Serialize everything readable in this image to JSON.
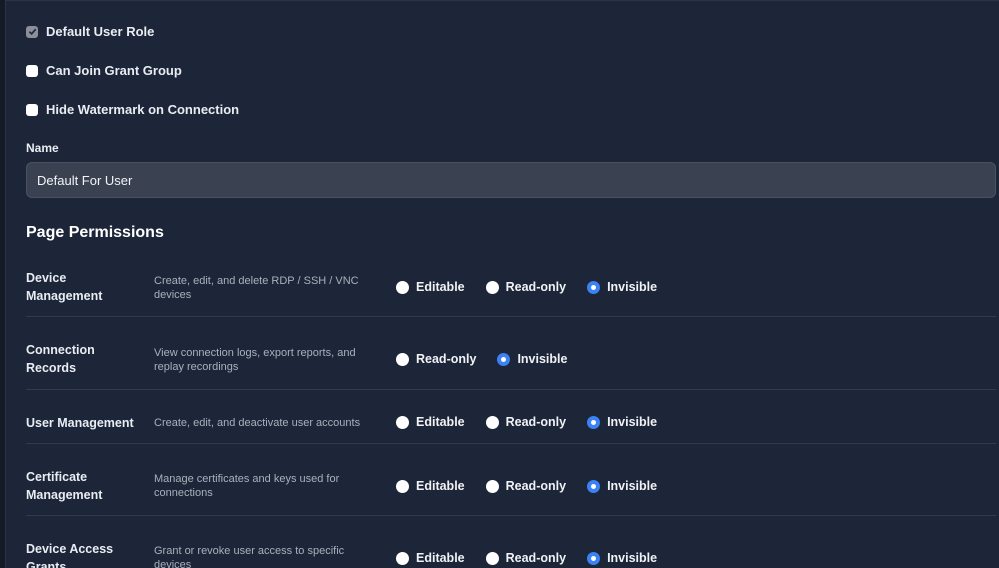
{
  "checkboxes": [
    {
      "label": "Default User Role",
      "checked": true
    },
    {
      "label": "Can Join Grant Group",
      "checked": false
    },
    {
      "label": "Hide Watermark on Connection",
      "checked": false
    }
  ],
  "name_field": {
    "label": "Name",
    "value": "Default For User"
  },
  "permissions": {
    "title": "Page Permissions",
    "rows": [
      {
        "name": "Device Management",
        "description": "Create, edit, and delete RDP / SSH / VNC devices",
        "options": [
          "Editable",
          "Read-only",
          "Invisible"
        ],
        "selected": "Invisible"
      },
      {
        "name": "Connection Records",
        "description": "View connection logs, export reports, and replay recordings",
        "options": [
          "Read-only",
          "Invisible"
        ],
        "selected": "Invisible"
      },
      {
        "name": "User Management",
        "description": "Create, edit, and deactivate user accounts",
        "options": [
          "Editable",
          "Read-only",
          "Invisible"
        ],
        "selected": "Invisible"
      },
      {
        "name": "Certificate Management",
        "description": "Manage certificates and keys used for connections",
        "options": [
          "Editable",
          "Read-only",
          "Invisible"
        ],
        "selected": "Invisible"
      },
      {
        "name": "Device Access Grants",
        "description": "Grant or revoke user access to specific devices",
        "options": [
          "Editable",
          "Read-only",
          "Invisible"
        ],
        "selected": "Invisible"
      }
    ]
  },
  "colors": {
    "accent": "#3b82f6",
    "panel": "#1d2638"
  }
}
